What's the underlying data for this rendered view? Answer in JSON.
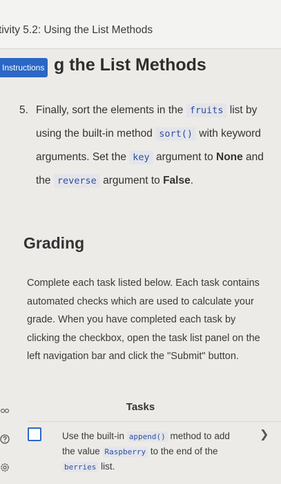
{
  "header": {
    "activity_title": "tivity 5.2: Using the List Methods"
  },
  "tab": {
    "instructions_label": "Instructions"
  },
  "main": {
    "heading": "g the List Methods"
  },
  "step": {
    "number": "5.",
    "p1": "Finally, sort the elements in the ",
    "c1": "fruits",
    "p2": " list by using the built-in method ",
    "c2": "sort()",
    "p3": " with keyword arguments. Set the ",
    "c3": "key",
    "p4": " argument to ",
    "b1": "None",
    "p5": " and the ",
    "c4": "reverse",
    "p6": " argument to ",
    "b2": "False",
    "p7": "."
  },
  "grading": {
    "title": "Grading",
    "text": "Complete each task listed below. Each task contains automated checks which are used to calculate your grade. When you have completed each task by clicking the checkbox, open the task list panel on the left navigation bar and click the \"Submit\" button."
  },
  "tasks": {
    "title": "Tasks",
    "items": [
      {
        "t1": "Use the built-in ",
        "c1": "append()",
        "t2": " method to add the value ",
        "c2": "Raspberry",
        "t3": " to the end of the ",
        "c3": "berries",
        "t4": " list.",
        "checked": false
      }
    ]
  },
  "left_rail": {
    "icons": [
      "glasses-icon",
      "help-icon",
      "settings-icon"
    ]
  },
  "colors": {
    "accent": "#2b67c5",
    "code_text": "#2e4e9e",
    "code_bg": "#e4e5ea"
  }
}
